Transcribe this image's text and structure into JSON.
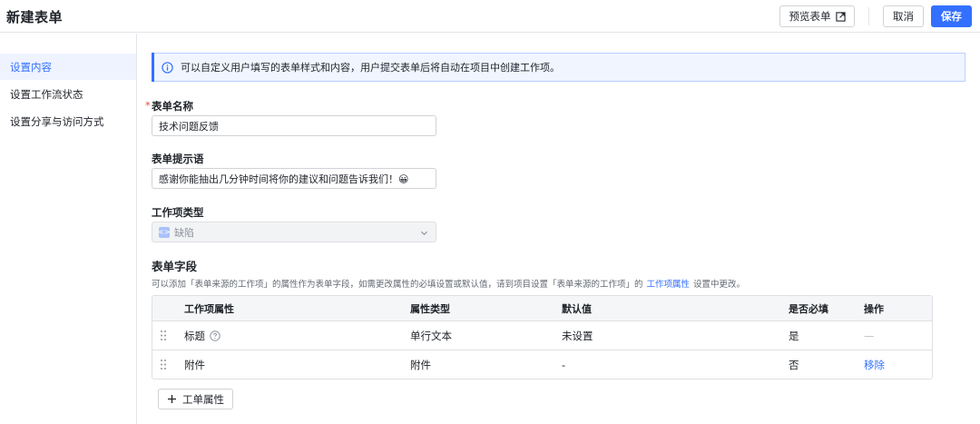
{
  "header": {
    "title": "新建表单",
    "preview_label": "预览表单",
    "cancel_label": "取消",
    "save_label": "保存"
  },
  "sidebar": {
    "items": [
      {
        "label": "设置内容",
        "active": true
      },
      {
        "label": "设置工作流状态",
        "active": false
      },
      {
        "label": "设置分享与访问方式",
        "active": false
      }
    ]
  },
  "notice": {
    "text": "可以自定义用户填写的表单样式和内容，用户提交表单后将自动在项目中创建工作项。"
  },
  "form": {
    "name_label": "表单名称",
    "name_required_mark": "*",
    "name_value": "技术问题反馈",
    "hint_label": "表单提示语",
    "hint_value": "感谢你能抽出几分钟时间将你的建议和问题告诉我们！😀",
    "type_label": "工作项类型",
    "type_value": "缺陷"
  },
  "fields": {
    "title": "表单字段",
    "desc_before": "可以添加「表单来源的工作项」的属性作为表单字段，如需更改属性的必填设置或默认值，请到项目设置「表单来源的工作项」的",
    "desc_link": "工作项属性",
    "desc_after": "设置中更改。",
    "columns": [
      "工作项属性",
      "属性类型",
      "默认值",
      "是否必填",
      "操作"
    ],
    "rows": [
      {
        "name": "标题",
        "type": "单行文本",
        "default": "未设置",
        "required": "是",
        "action": "—"
      },
      {
        "name": "附件",
        "type": "附件",
        "default": "-",
        "required": "否",
        "action": "移除"
      }
    ],
    "add_label": "工单属性"
  },
  "colors": {
    "accent": "#3370ff",
    "required": "#f54a45",
    "notice_bg": "#f0f5ff"
  }
}
